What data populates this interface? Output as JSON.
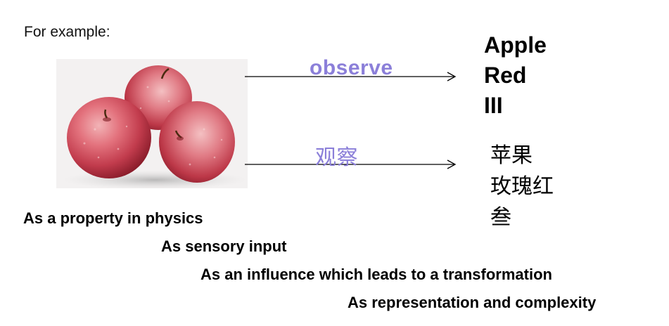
{
  "intro": "For example:",
  "image": {
    "subject": "three red apples",
    "colors": {
      "apple_light": "#e98a8f",
      "apple_mid": "#c8404f",
      "apple_dark": "#8c1c2a",
      "background": "#f2f2f2"
    }
  },
  "arrows": [
    {
      "label": "observe",
      "label_color": "#8b7fd9",
      "results": [
        "Apple",
        "Red",
        "III"
      ]
    },
    {
      "label": "观察",
      "label_color": "#8b7fd9",
      "results": [
        "苹果",
        "玫瑰红",
        "叁"
      ]
    }
  ],
  "aspects": [
    "As a property in physics",
    "As sensory input",
    "As an influence which leads to a transformation",
    "As representation and complexity"
  ]
}
